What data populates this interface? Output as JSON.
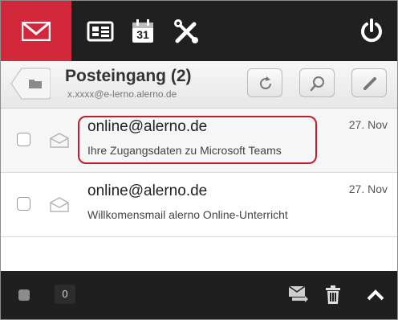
{
  "folder": {
    "title": "Posteingang (2)",
    "account": "x.xxxx@e-lerno.alerno.de"
  },
  "messages": [
    {
      "sender": "online@alerno.de",
      "subject": "Ihre Zugangsdaten zu Microsoft Teams",
      "date": "27. Nov"
    },
    {
      "sender": "online@alerno.de",
      "subject": "Willkomensmail alerno Online-Unterricht",
      "date": "27. Nov"
    }
  ],
  "bottom": {
    "selected_count": "0"
  },
  "calendar": {
    "day": "31"
  },
  "colors": {
    "accent": "#d3283b",
    "toolbar": "#202020",
    "highlight": "#c21d2e"
  },
  "icons": [
    "mail-icon",
    "address-card-icon",
    "calendar-icon",
    "tools-icon",
    "power-icon",
    "folder-icon",
    "refresh-icon",
    "search-icon",
    "compose-icon",
    "envelope-icon",
    "move-icon",
    "trash-icon",
    "chevron-up-icon"
  ]
}
